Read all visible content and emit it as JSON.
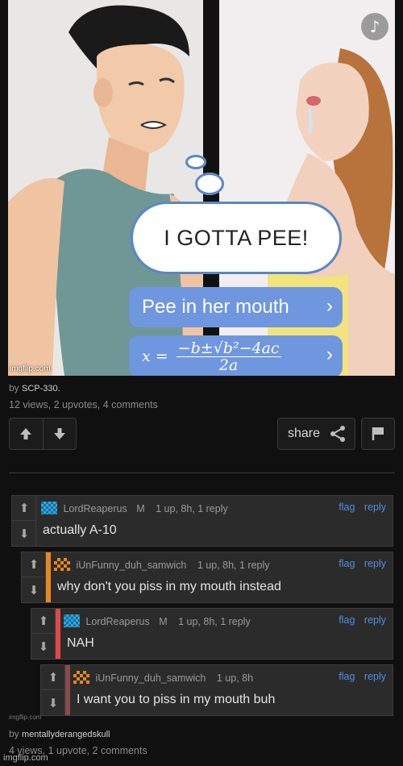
{
  "meme": {
    "music_icon": "music-note-icon",
    "thought": "I GOTTA PEE!",
    "option1": "Pee in her mouth",
    "option2_lhs": "x =",
    "option2_num": "−b±√b²−4ac",
    "option2_den": "2a",
    "chevron": "›",
    "watermark": "imgflip.com"
  },
  "post": {
    "by_prefix": "by",
    "author": "SCP-330.",
    "stats": "12 views, 2 upvotes, 4 comments",
    "share_label": "share"
  },
  "comments": [
    {
      "user": "LordReaperus",
      "mod": "M",
      "meta": "1 up, 8h, 1 reply",
      "flag": "flag",
      "reply": "reply",
      "text": "actually A-10",
      "bar": "#2b2b2b",
      "avatar_color": "#2ea6e0"
    },
    {
      "user": "iUnFunny_duh_samwich",
      "mod": "",
      "meta": "1 up, 8h, 1 reply",
      "flag": "flag",
      "reply": "reply",
      "text": "why don't you piss in my mouth instead",
      "bar": "#e8871e",
      "avatar_color": "#e8871e"
    },
    {
      "user": "LordReaperus",
      "mod": "M",
      "meta": "1 up, 8h, 1 reply",
      "flag": "flag",
      "reply": "reply",
      "text": "NAH",
      "bar": "#e04848",
      "avatar_color": "#2ea6e0"
    },
    {
      "user": "iUnFunny_duh_samwich",
      "mod": "",
      "meta": "1 up, 8h",
      "flag": "flag",
      "reply": "reply",
      "text": "I want you to piss in my mouth buh",
      "bar": "#8a4a4a",
      "avatar_color": "#e8871e"
    }
  ],
  "bottom": {
    "watermark_small": "imgflip.com",
    "by_prefix": "by",
    "author": "mentallyderangedskull",
    "stats": "4 views, 1 upvote, 2 comments",
    "watermark": "imgflip.com"
  }
}
